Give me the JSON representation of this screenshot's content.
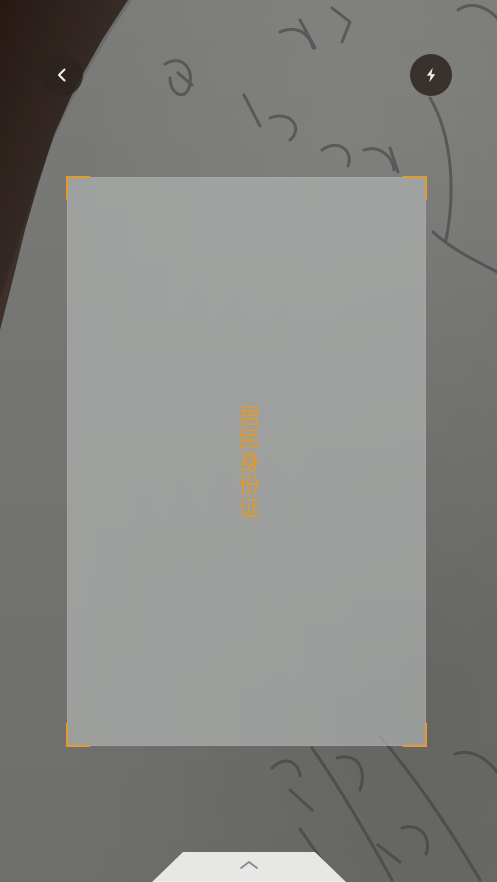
{
  "header": {
    "back_icon": "chevron-left-icon",
    "flash_icon": "flash-icon"
  },
  "scan_frame": {
    "label": "居民身份证",
    "accent_color": "#e39b2c"
  },
  "bottom_sheet": {
    "handle_icon": "chevron-up-icon"
  }
}
